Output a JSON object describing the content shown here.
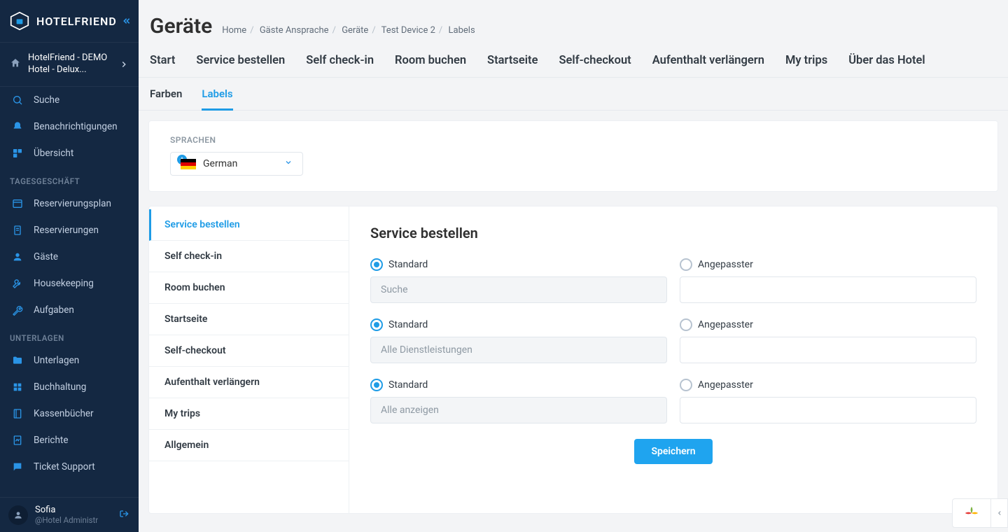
{
  "brand": "HOTELFRIEND",
  "hotel_switch": "HotelFriend - DEMO Hotel - Delux...",
  "sidebar": {
    "items": [
      {
        "label": "Suche"
      },
      {
        "label": "Benachrichtigungen"
      },
      {
        "label": "Übersicht"
      }
    ],
    "group1": "TAGESGESCHÄFT",
    "g1items": [
      {
        "label": "Reservierungsplan"
      },
      {
        "label": "Reservierungen"
      },
      {
        "label": "Gäste"
      },
      {
        "label": "Housekeeping"
      },
      {
        "label": "Aufgaben"
      }
    ],
    "group2": "UNTERLAGEN",
    "g2items": [
      {
        "label": "Unterlagen"
      },
      {
        "label": "Buchhaltung"
      },
      {
        "label": "Kassenbücher"
      },
      {
        "label": "Berichte"
      },
      {
        "label": "Ticket Support"
      }
    ]
  },
  "user": {
    "name": "Sofia",
    "role": "@Hotel Administr"
  },
  "page": {
    "title": "Geräte",
    "crumbs": [
      "Home",
      "Gäste Ansprache",
      "Geräte",
      "Test Device 2",
      "Labels"
    ],
    "tabs1": [
      "Start",
      "Service bestellen",
      "Self check-in",
      "Room buchen",
      "Startseite",
      "Self-checkout",
      "Aufenthalt verlängern",
      "My trips",
      "Über das Hotel"
    ],
    "tabs2": [
      "Farben",
      "Labels"
    ],
    "tabs2_active": 1
  },
  "lang": {
    "section": "SPRACHEN",
    "value": "German"
  },
  "sections": [
    "Service bestellen",
    "Self check-in",
    "Room buchen",
    "Startseite",
    "Self-checkout",
    "Aufenthalt verlängern",
    "My trips",
    "Allgemein"
  ],
  "sections_active": 0,
  "editor": {
    "title": "Service bestellen",
    "std": "Standard",
    "custom": "Angepasster",
    "rows": [
      {
        "placeholder": "Suche"
      },
      {
        "placeholder": "Alle Dienstleistungen"
      },
      {
        "placeholder": "Alle anzeigen"
      }
    ],
    "save": "Speichern"
  }
}
